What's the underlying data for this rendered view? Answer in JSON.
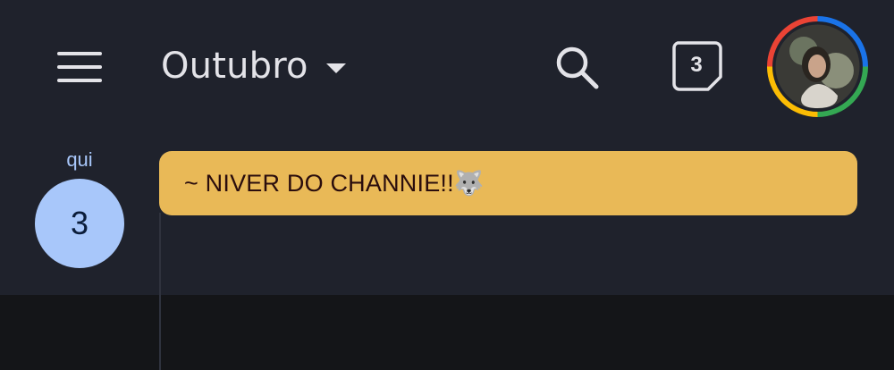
{
  "header": {
    "menu_icon": "hamburger-menu-icon",
    "month": "Outubro",
    "month_dropdown_icon": "caret-down-icon",
    "search_icon": "search-icon",
    "today_icon": "calendar-today-icon",
    "today_day": "3",
    "avatar_icon": "profile-avatar"
  },
  "day": {
    "weekday": "qui",
    "number": "3"
  },
  "events": [
    {
      "title": "~ NIVER DO CHANNIE!!🐺",
      "color": "#e9b957"
    }
  ],
  "colors": {
    "background": "#1f222c",
    "accent": "#a8c7fa",
    "event": "#e9b957",
    "bottom": "#141518"
  }
}
